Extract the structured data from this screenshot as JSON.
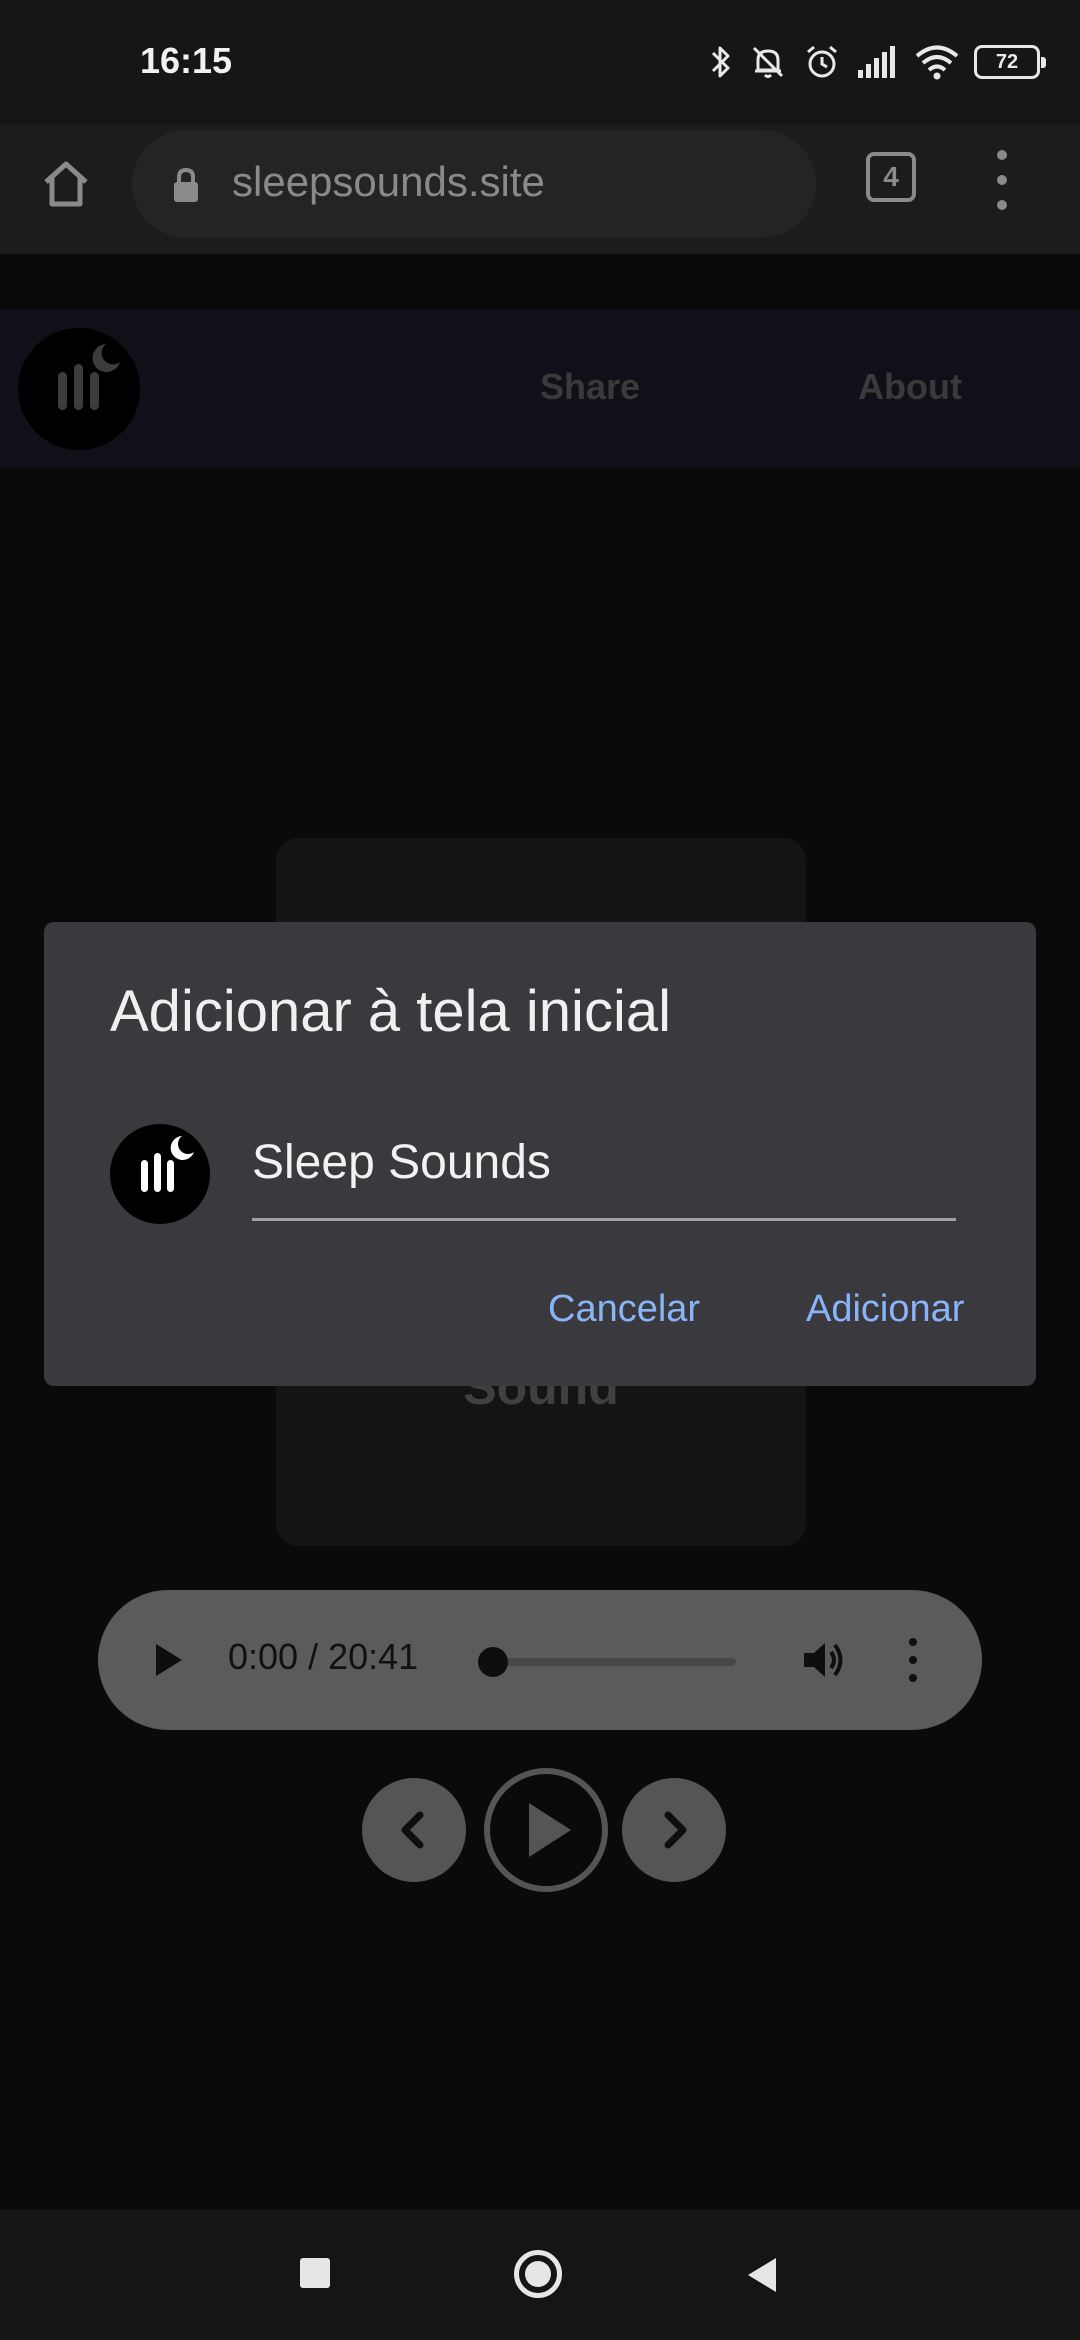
{
  "status_bar": {
    "time": "16:15",
    "battery": "72",
    "icons": [
      "bluetooth-icon",
      "notifications-off-icon",
      "alarm-icon",
      "signal-icon",
      "wifi-icon",
      "battery-icon"
    ]
  },
  "browser": {
    "url": "sleepsounds.site",
    "tab_count": "4"
  },
  "site": {
    "nav": {
      "share": "Share",
      "about": "About"
    },
    "card_label": "Sound"
  },
  "player": {
    "time": "0:00 / 20:41",
    "progress": 0
  },
  "dialog": {
    "title": "Adicionar à tela inicial",
    "app_name": "Sleep Sounds",
    "cancel_label": "Cancelar",
    "add_label": "Adicionar"
  },
  "colors": {
    "dialog_bg": "#3a3a3e",
    "accent": "#8ab4f8",
    "scrim": "#0a0a0a"
  }
}
